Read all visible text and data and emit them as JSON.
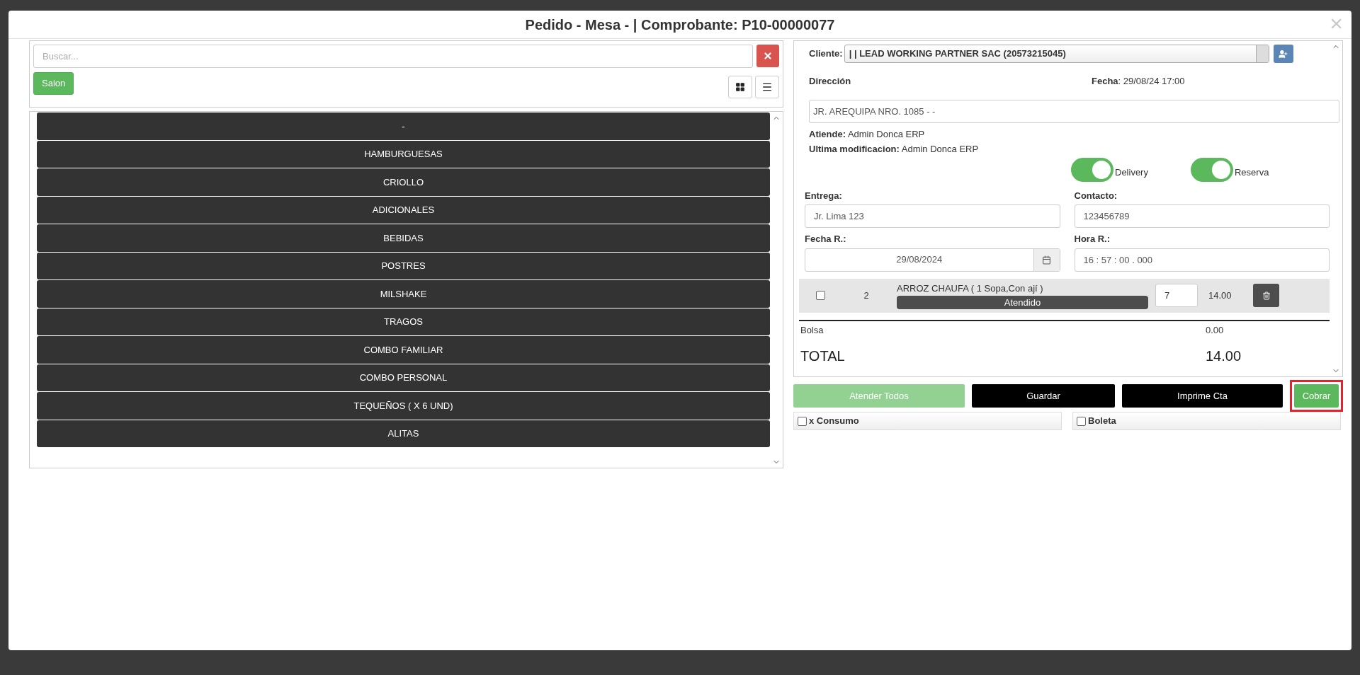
{
  "modal": {
    "title": "Pedido - Mesa - | Comprobante: P10-00000077",
    "close": "×"
  },
  "search": {
    "placeholder": "Buscar...",
    "zone_button": "Salon"
  },
  "categories": [
    {
      "label": "-"
    },
    {
      "label": "HAMBURGUESAS"
    },
    {
      "label": "CRIOLLO"
    },
    {
      "label": "ADICIONALES"
    },
    {
      "label": "BEBIDAS"
    },
    {
      "label": "POSTRES"
    },
    {
      "label": "MILSHAKE"
    },
    {
      "label": "TRAGOS"
    },
    {
      "label": "COMBO FAMILIAR"
    },
    {
      "label": "COMBO PERSONAL"
    },
    {
      "label": "TEQUEÑOS ( X 6 UND)"
    },
    {
      "label": "ALITAS"
    }
  ],
  "order": {
    "client_label": "Cliente:",
    "client_value": "| | LEAD WORKING PARTNER SAC (20573215045)",
    "address_label": "Dirección",
    "date": "**Fecha**: 29/08/24 17:00",
    "address_value": "JR. AREQUIPA NRO. 1085 - -",
    "attends": "**Atiende:** Admin Donca ERP",
    "modified": "**Ultima modificacion:** Admin Donca ERP",
    "toggles": [
      {
        "label": "Delivery",
        "on": true
      },
      {
        "label": "Reserva",
        "on": true
      }
    ],
    "delivery_label": "Entrega:",
    "delivery_value": "Jr. Lima 123",
    "contact_label": "Contacto:",
    "contact_value": "123456789",
    "res_date_label": "Fecha R.:",
    "res_date_value": "29/08/2024",
    "res_time_label": "Hora R.:",
    "res_time_value": "16 : 57 : 00 . 000",
    "items": [
      {
        "checked": false,
        "number": "2",
        "name": "ARROZ CHAUFA ( 1 Sopa,Con ají )",
        "status": "Atendido",
        "quantity": "7",
        "amount": "14.00"
      }
    ],
    "bag_label": "Bolsa",
    "bag_value": "0.00",
    "total_label": "TOTAL",
    "total_value": "14.00"
  },
  "actions": [
    {
      "label": "Atender Todos",
      "kind": "disabled"
    },
    {
      "label": "Guardar",
      "kind": "dark"
    },
    {
      "label": "Imprime Cta",
      "kind": "dark"
    },
    {
      "label": "Cobrar",
      "kind": "highlighted"
    }
  ],
  "options": [
    {
      "label": "x Consumo",
      "checked": false
    },
    {
      "label": "Boleta",
      "checked": false
    }
  ]
}
